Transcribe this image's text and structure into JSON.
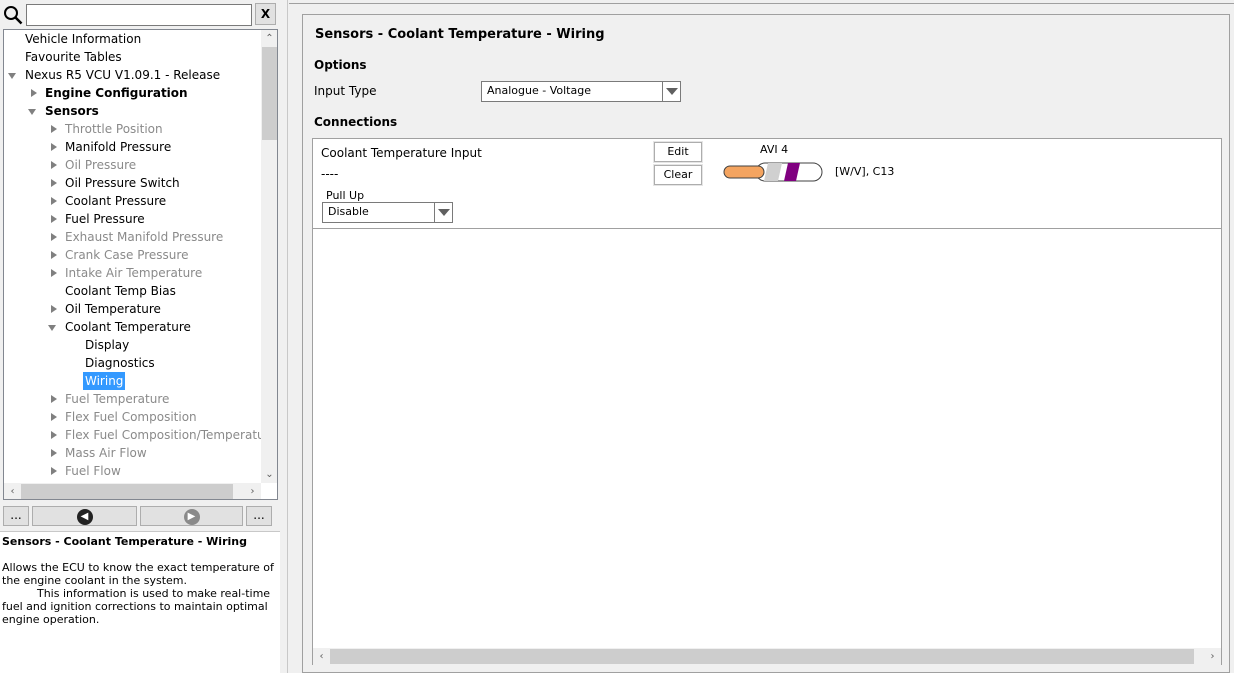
{
  "search": {
    "value": "",
    "clear_label": "X"
  },
  "tree": {
    "items": [
      {
        "label": "Vehicle Information"
      },
      {
        "label": "Favourite Tables"
      },
      {
        "label": "Nexus R5 VCU V1.09.1 - Release"
      },
      {
        "label": "Engine Configuration"
      },
      {
        "label": "Sensors"
      },
      {
        "label": "Throttle Position"
      },
      {
        "label": "Manifold Pressure"
      },
      {
        "label": "Oil Pressure"
      },
      {
        "label": "Oil Pressure Switch"
      },
      {
        "label": "Coolant Pressure"
      },
      {
        "label": "Fuel Pressure"
      },
      {
        "label": "Exhaust Manifold Pressure"
      },
      {
        "label": "Crank Case Pressure"
      },
      {
        "label": "Intake Air Temperature"
      },
      {
        "label": "Coolant Temp Bias"
      },
      {
        "label": "Oil Temperature"
      },
      {
        "label": "Coolant Temperature"
      },
      {
        "label": "Display"
      },
      {
        "label": "Diagnostics"
      },
      {
        "label": "Wiring"
      },
      {
        "label": "Fuel Temperature"
      },
      {
        "label": "Flex Fuel Composition"
      },
      {
        "label": "Flex Fuel Composition/Temperature S"
      },
      {
        "label": "Mass Air Flow"
      },
      {
        "label": "Fuel Flow"
      }
    ]
  },
  "nav": {
    "more_left": "...",
    "more_right": "...",
    "back_icon": "chevron-left-icon",
    "forward_icon": "chevron-right-icon"
  },
  "description": {
    "title": "Sensors - Coolant Temperature - Wiring",
    "body": "Allows the ECU to know the exact temperature of the engine coolant in the system.\n          This information is used to make real-time fuel and ignition corrections to maintain optimal engine operation."
  },
  "page": {
    "title": "Sensors - Coolant Temperature - Wiring",
    "options_label": "Options",
    "input_type_label": "Input Type",
    "input_type_value": "Analogue - Voltage",
    "connections_label": "Connections"
  },
  "connection": {
    "name": "Coolant Temperature Input",
    "value": "----",
    "pullup_label": "Pull Up",
    "pullup_value": "Disable",
    "edit_label": "Edit",
    "clear_label": "Clear",
    "pin": "AVI 4",
    "pin_detail": "[W/V], C13",
    "wire_colors": {
      "core": "#f4a460",
      "stripe": "#800080",
      "sheath": "#ffffff"
    }
  }
}
